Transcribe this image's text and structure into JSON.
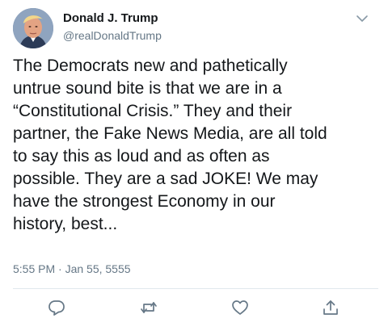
{
  "author": {
    "name": "Donald J. Trump",
    "handle": "@realDonaldTrump",
    "avatar_icon": "profile-photo"
  },
  "tweet": {
    "lines": [
      "The Democrats new and pathetically",
      "untrue sound bite is that we are in a",
      "“Constitutional Crisis.” They and their",
      "partner, the Fake News Media, are all told",
      "to say this as loud and as often as",
      "possible. They are a sad JOKE! We may",
      "have the strongest Economy in our",
      "history, best..."
    ],
    "timestamp": "5:55 PM · Jan 55, 5555"
  },
  "actions": {
    "reply_icon": "reply-icon",
    "retweet_icon": "retweet-icon",
    "like_icon": "heart-icon",
    "share_icon": "share-icon"
  },
  "colors": {
    "text": "#14171a",
    "secondary": "#657786",
    "divider": "#e1e8ed",
    "icon": "#657786"
  }
}
